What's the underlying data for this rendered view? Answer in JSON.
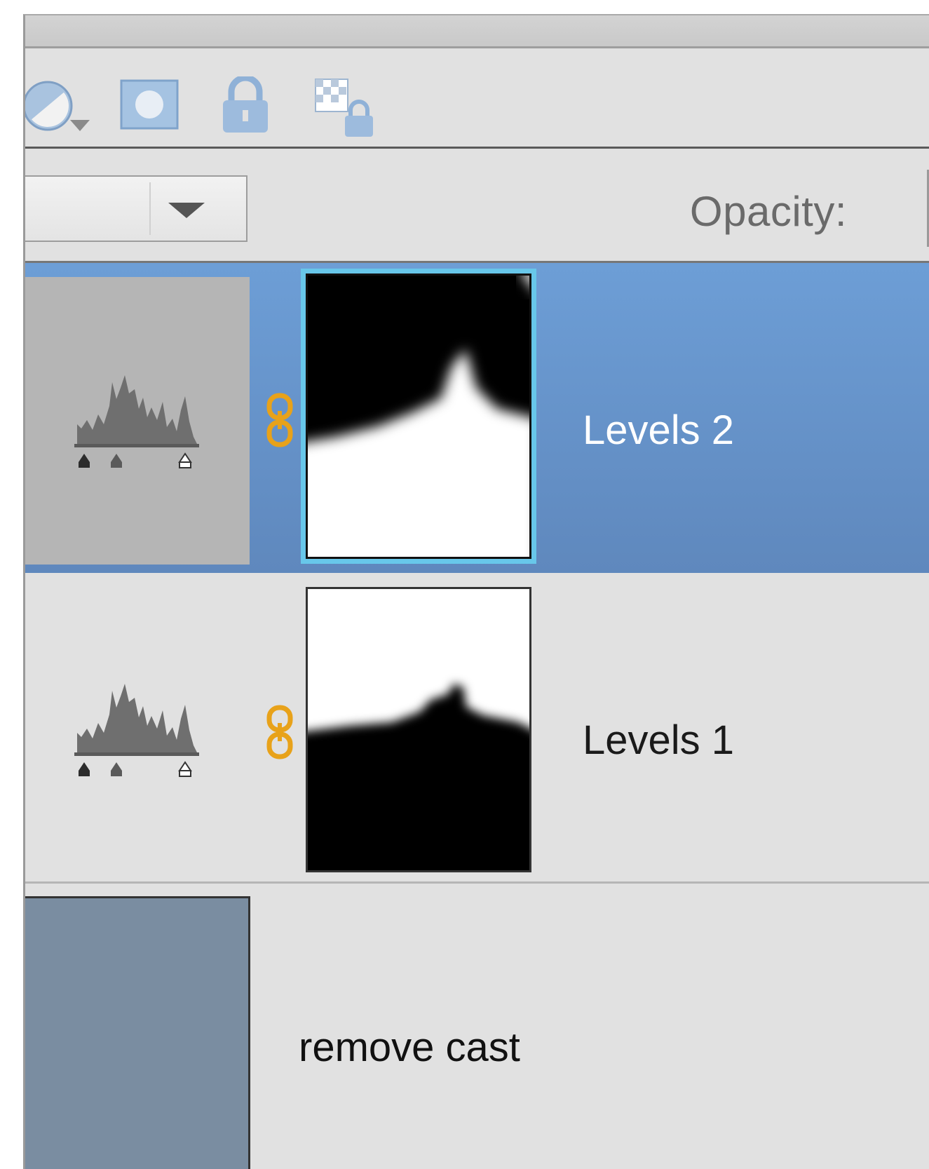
{
  "toolbar": {
    "icons": [
      "adjustment-layer-icon",
      "layer-mask-icon",
      "lock-all-icon",
      "lock-transparency-icon"
    ]
  },
  "controls": {
    "blend_mode_value": "",
    "opacity_label": "Opacity:"
  },
  "layers": [
    {
      "name": "Levels 2",
      "selected": true,
      "type": "levels"
    },
    {
      "name": "Levels 1",
      "selected": false,
      "type": "levels"
    },
    {
      "name": "remove cast",
      "selected": false,
      "type": "fill",
      "color": "#7a8da1"
    }
  ],
  "colors": {
    "selection": "#6a98d0",
    "mask_highlight": "#68c7ea",
    "link": "#e8a21a"
  }
}
